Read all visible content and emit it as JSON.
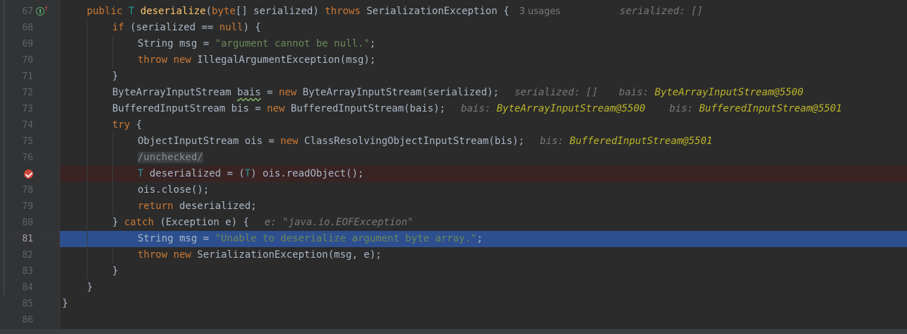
{
  "editor": {
    "usages_hint": "3 usages",
    "lines": [
      {
        "num": "67"
      },
      {
        "num": "68"
      },
      {
        "num": "69"
      },
      {
        "num": "70"
      },
      {
        "num": "71"
      },
      {
        "num": "72"
      },
      {
        "num": "73"
      },
      {
        "num": "74"
      },
      {
        "num": "75"
      },
      {
        "num": "76"
      },
      {
        "num": "77"
      },
      {
        "num": "78"
      },
      {
        "num": "79"
      },
      {
        "num": "80"
      },
      {
        "num": "81"
      },
      {
        "num": "82"
      },
      {
        "num": "83"
      },
      {
        "num": "84"
      },
      {
        "num": "85"
      },
      {
        "num": "86"
      }
    ],
    "inline_values": {
      "l67_serialized": "serialized: []",
      "l72_serialized": "serialized: []",
      "l72_bais_label": "bais:",
      "l72_bais_value": "ByteArrayInputStream@5500",
      "l73_bais_label": "bais:",
      "l73_bais_value": "ByteArrayInputStream@5500",
      "l73_bis_label": "bis:",
      "l73_bis_value": "BufferedInputStream@5501",
      "l75_bis_label": "bis:",
      "l75_bis_value": "BufferedInputStream@5501",
      "l80_e": "e: \"java.io.EOFException\""
    },
    "colors": {
      "background": "#2b2b2b",
      "keyword": "#cc7832",
      "string": "#6a8759",
      "method": "#ffc66d",
      "type_param": "#20999d",
      "current_line": "#2d4f8f",
      "breakpoint_line": "#3a2323"
    },
    "icons": {
      "breakpoint": "breakpoint-icon",
      "override": "override-method-icon"
    }
  }
}
